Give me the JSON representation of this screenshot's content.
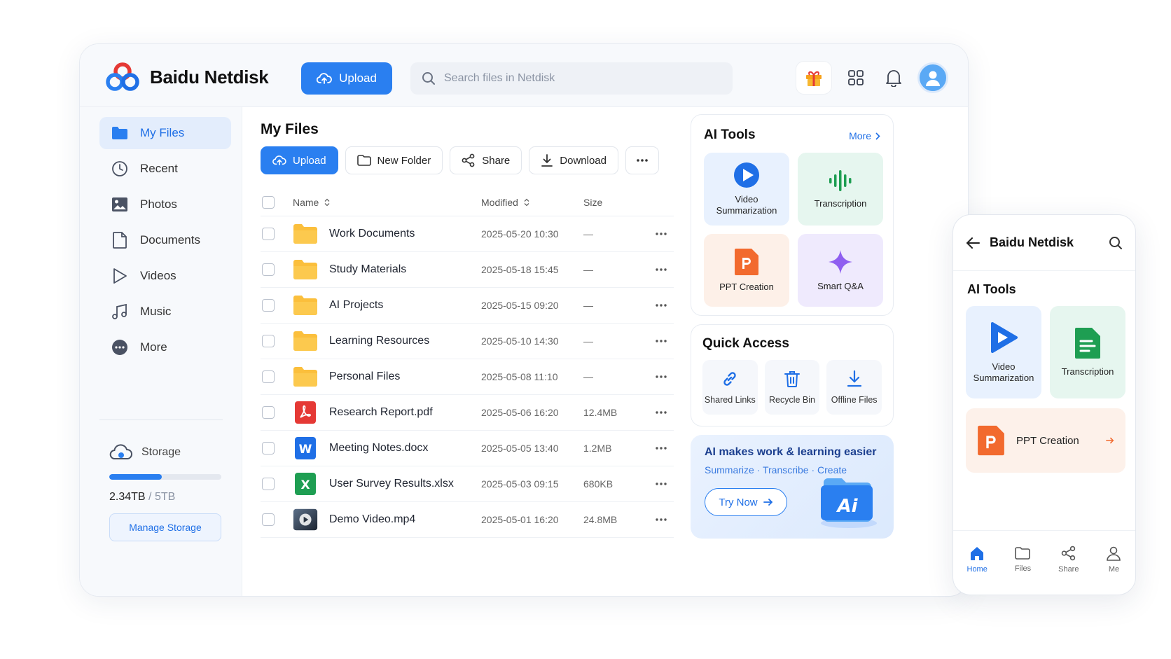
{
  "app": {
    "title": "Baidu Netdisk"
  },
  "header": {
    "upload_label": "Upload",
    "search_placeholder": "Search files in Netdisk"
  },
  "sidebar": {
    "items": [
      {
        "label": "My Files",
        "icon": "folder-icon"
      },
      {
        "label": "Recent",
        "icon": "clock-icon"
      },
      {
        "label": "Photos",
        "icon": "image-icon"
      },
      {
        "label": "Documents",
        "icon": "document-icon"
      },
      {
        "label": "Videos",
        "icon": "play-icon"
      },
      {
        "label": "Music",
        "icon": "music-icon"
      },
      {
        "label": "More",
        "icon": "more-circle-icon"
      }
    ],
    "storage": {
      "label": "Storage",
      "used": "2.34TB",
      "total": "/ 5TB",
      "used_fraction": 0.468,
      "manage_label": "Manage Storage"
    }
  },
  "main": {
    "title": "My Files",
    "toolbar": {
      "upload": "Upload",
      "new_folder": "New Folder",
      "share": "Share",
      "download": "Download"
    },
    "columns": {
      "name": "Name",
      "modified": "Modified",
      "size": "Size"
    },
    "files": [
      {
        "name": "Work Documents",
        "modified": "2025-05-20 10:30",
        "size": "—",
        "type": "folder"
      },
      {
        "name": "Study Materials",
        "modified": "2025-05-18 15:45",
        "size": "—",
        "type": "folder"
      },
      {
        "name": "AI Projects",
        "modified": "2025-05-15 09:20",
        "size": "—",
        "type": "folder"
      },
      {
        "name": "Learning Resources",
        "modified": "2025-05-10 14:30",
        "size": "—",
        "type": "folder"
      },
      {
        "name": "Personal Files",
        "modified": "2025-05-08 11:10",
        "size": "—",
        "type": "folder"
      },
      {
        "name": "Research Report.pdf",
        "modified": "2025-05-06 16:20",
        "size": "12.4MB",
        "type": "pdf"
      },
      {
        "name": "Meeting Notes.docx",
        "modified": "2025-05-05 13:40",
        "size": "1.2MB",
        "type": "word"
      },
      {
        "name": "User Survey Results.xlsx",
        "modified": "2025-05-03 09:15",
        "size": "680KB",
        "type": "excel"
      },
      {
        "name": "Demo Video.mp4",
        "modified": "2025-05-01 16:20",
        "size": "24.8MB",
        "type": "video"
      }
    ]
  },
  "ai_tools": {
    "title": "AI Tools",
    "more": "More",
    "tiles": [
      {
        "l1": "Video",
        "l2": "Summarization",
        "icon": "play-icon"
      },
      {
        "l1": "Transcription",
        "l2": "",
        "icon": "waveform-icon"
      },
      {
        "l1": "PPT Creation",
        "l2": "",
        "icon": "ppt-icon"
      },
      {
        "l1": "Smart Q&A",
        "l2": "",
        "icon": "sparkle-icon"
      }
    ]
  },
  "quick_access": {
    "title": "Quick Access",
    "items": [
      {
        "label": "Shared Links",
        "icon": "link-icon"
      },
      {
        "label": "Recycle Bin",
        "icon": "trash-icon"
      },
      {
        "label": "Offline Files",
        "icon": "download-icon"
      }
    ]
  },
  "promo": {
    "title": "AI makes work & learning easier",
    "subtitle": "Summarize · Transcribe · Create",
    "cta": "Try Now",
    "badge": "Ai"
  },
  "mobile": {
    "title": "Baidu Netdisk",
    "section": "AI Tools",
    "tiles": [
      {
        "l1": "Video",
        "l2": "Summarization"
      },
      {
        "l1": "Transcription",
        "l2": ""
      }
    ],
    "ppt": "PPT Creation",
    "nav": [
      {
        "label": "Home",
        "icon": "home-icon"
      },
      {
        "label": "Files",
        "icon": "folder-icon"
      },
      {
        "label": "Share",
        "icon": "share-icon"
      },
      {
        "label": "Me",
        "icon": "user-icon"
      }
    ]
  },
  "colors": {
    "accent": "#2a7ff0",
    "folder": "#fbbf3c",
    "pdf": "#e53935",
    "word": "#1f6fe6",
    "excel": "#1e9e52",
    "ppt": "#f26a2e"
  }
}
